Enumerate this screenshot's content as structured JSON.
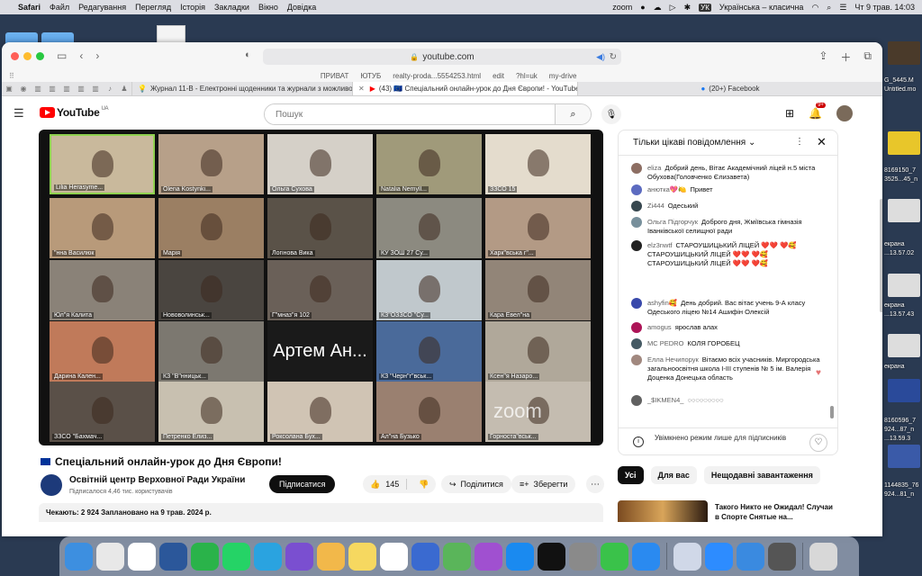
{
  "menubar": {
    "app": "Safari",
    "items": [
      "Файл",
      "Редагування",
      "Перегляд",
      "Історія",
      "Закладки",
      "Вікно",
      "Довідка"
    ],
    "zoom": "zoom",
    "keyboard_badge": "УК",
    "keyboard_layout": "Українська – класична",
    "datetime": "Чт 9 трав.  14:03"
  },
  "desktop": {
    "labels": [
      "G_5445.M",
      "Untitled.mo",
      "8169150_7",
      "3525...45_n",
      "екрана",
      "...13.57.02",
      "екрана",
      "...13.57.43",
      "екрана",
      "8160596_7",
      "924...87_n",
      "...13.59.3",
      "1144835_76",
      "924...81_n"
    ]
  },
  "safari": {
    "url": "youtube.com",
    "favorites": [
      "ПРИВАТ",
      "ЮТУБ",
      "realty-proda...5554253.html",
      "edit",
      "?hl=uk",
      "my-drive"
    ],
    "tabs": [
      {
        "label": "Журнал 11-В - Електронні щоденники та журнали з можливост..."
      },
      {
        "label": "(43) 🇪🇺 Спеціальний онлайн-урок до Дня Європи! - YouTube"
      },
      {
        "label": "(20+) Facebook"
      }
    ]
  },
  "youtube": {
    "logo": "YouTube",
    "region": "UA",
    "search_placeholder": "Пошук",
    "notifications": "9+",
    "video_tiles": [
      {
        "name": "Lilia Herasyme...",
        "bg": "#c9b99c"
      },
      {
        "name": "Olena Kostynki...",
        "bg": "#b7a089"
      },
      {
        "name": "Ольга Сухова",
        "bg": "#d5d0c8"
      },
      {
        "name": "Natalia Nemyll...",
        "bg": "#a09a7a"
      },
      {
        "name": "ЗЗСО 15",
        "bg": "#e4dccd"
      },
      {
        "name": "\"нна Василюк",
        "bg": "#b89a7a"
      },
      {
        "name": "Марія",
        "bg": "#9b7f63"
      },
      {
        "name": "Логінова Вика",
        "bg": "#5a5248"
      },
      {
        "name": "КУ ЗОШ 27 Су...",
        "bg": "#8c8a80"
      },
      {
        "name": "Харк\"вська г\"...",
        "bg": "#b39a85"
      },
      {
        "name": "Юл\"я Калита",
        "bg": "#8a8278"
      },
      {
        "name": "Нововолинськ...",
        "bg": "#4a4540"
      },
      {
        "name": "Г\"мназ\"я 102",
        "bg": "#6a6058"
      },
      {
        "name": "КЗ\"ОЗЗСО \"Су...",
        "bg": "#c0c8cc"
      },
      {
        "name": "Кара Евел\"на",
        "bg": "#928578"
      },
      {
        "name": "Дарина Кален...",
        "bg": "#c07a5a"
      },
      {
        "name": "КЗ \"В\"нницьк...",
        "bg": "#7c7870"
      },
      {
        "name": "",
        "bg": "#1a1a1a",
        "text": "Артем Ан..."
      },
      {
        "name": "КЗ \"Черн\"г\"вськ...",
        "bg": "#4a6a9a"
      },
      {
        "name": "Ксен\"я Назаро...",
        "bg": "#b0a89a"
      },
      {
        "name": "ЗЗСО \"Бахмач...",
        "bg": "#5a5048"
      },
      {
        "name": "Петренко Елиз...",
        "bg": "#c8c0b0"
      },
      {
        "name": "Роксолана Бух...",
        "bg": "#d0c4b4"
      },
      {
        "name": "Ал\"на Бузько",
        "bg": "#9a8070"
      },
      {
        "name": "Горноста\"вськ...",
        "bg": "#c4bcb0"
      }
    ],
    "zoom_watermark": "zoom",
    "video_title": "Спеціальний онлайн-урок до Дня Європи!",
    "channel_name": "Освітній центр Верховної Ради України",
    "channel_subs": "Підписалося 4,46 тис. користувачів",
    "subscribe": "Підписатися",
    "likes": "145",
    "share": "Поділитися",
    "save": "Зберегти",
    "description": "Чекають: 2 924  Заплановано на 9 трав. 2024 р."
  },
  "chat": {
    "mode": "Тільки цікаві повідомлення",
    "messages": [
      {
        "author": "eliza",
        "text": "Добрий день, Вітає Академічний ліцей н.5 міста Обухова(Головченко Єлизавета)",
        "color": "#8d6e63"
      },
      {
        "author": "анютка💖🍋",
        "text": "Привет",
        "color": "#5c6bc0"
      },
      {
        "author": "Zi444",
        "text": "Одеський",
        "color": "#37474f"
      },
      {
        "author": "Ольга Підгорчук",
        "text": "Доброго дня, Жміївська гімназія Іванківської селищної ради",
        "color": "#78909c"
      },
      {
        "author": "elz3nwtf",
        "text": "СТАРОУШИЦЬКИЙ ЛІЦЕЙ ❤️❤️ ❤️🥰СТАРОУШИЦЬКИЙ ЛІЦЕЙ ❤️❤️ ❤️🥰СТАРОУШИЦЬКИЙ ЛІЦЕЙ ❤️❤️ ❤️🥰",
        "color": "#212121"
      },
      {
        "author": "ashyfin🥰",
        "text": "День добрий. Вас вітає учень 9-А класу Одеського ліцею №14 Ашифін Олексій",
        "color": "#3949ab"
      },
      {
        "author": "amogus",
        "text": "ярослав алах",
        "color": "#ad1457"
      },
      {
        "author": "MC PEDRO",
        "text": "КОЛЯ ГОРОБЕЦ",
        "color": "#455a64"
      },
      {
        "author": "Елла Нечипорук",
        "text": "Вітаємо всіх учасників. Миргородська загальноосвітня школа І-ІІІ ступенів № 5 ім. Валерія Доценка Донецька область",
        "color": "#a1887f"
      },
      {
        "author": "_$IKMEN4_",
        "text": "◌◌◌◌◌◌◌◌◌",
        "color": "#616161"
      }
    ],
    "footer": "Увімкнено режим лише для підписників"
  },
  "chips": [
    "Усі",
    "Для вас",
    "Нещодавні завантаження"
  ],
  "recommendation": {
    "title": "Такого Никто не Ожидал! Случаи в Спорте Снятые на..."
  },
  "dock": {
    "apps": [
      "finder",
      "launchpad",
      "chrome",
      "word",
      "facetime",
      "whatsapp",
      "telegram",
      "viber",
      "photos",
      "notes",
      "freeform",
      "keynote",
      "maps",
      "podcasts",
      "app-store",
      "apple-tv",
      "settings",
      "messages",
      "safari",
      "preview",
      "zoom",
      "mail",
      "automator",
      "trash"
    ]
  }
}
